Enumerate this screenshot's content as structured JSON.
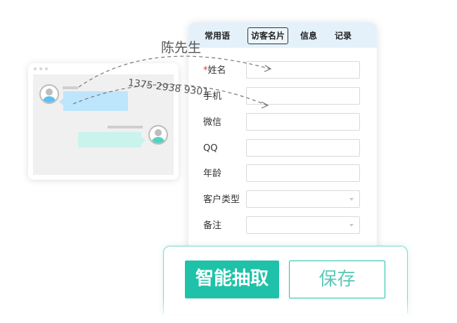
{
  "tabs": [
    "常用语",
    "访客名片",
    "信息",
    "记录"
  ],
  "active_tab": "访客名片",
  "fields": [
    {
      "label": "姓名",
      "required": true,
      "type": "text",
      "value": ""
    },
    {
      "label": "手机",
      "required": false,
      "type": "text",
      "value": ""
    },
    {
      "label": "微信",
      "required": false,
      "type": "text",
      "value": ""
    },
    {
      "label": "QQ",
      "required": false,
      "type": "text",
      "value": ""
    },
    {
      "label": "年龄",
      "required": false,
      "type": "text",
      "value": ""
    },
    {
      "label": "客户类型",
      "required": false,
      "type": "select",
      "value": ""
    },
    {
      "label": "备注",
      "required": false,
      "type": "select",
      "value": ""
    }
  ],
  "required_mark": "*",
  "annotations": {
    "name": "陈先生",
    "phone": "1375 2938 9301"
  },
  "actions": {
    "extract_label": "智能抽取",
    "save_label": "保存"
  },
  "colors": {
    "accent": "#1fc2a8",
    "tab_bar_bg": "#e4f1fb",
    "required": "#e03434",
    "left_bubble": "#bde5fb",
    "right_bubble": "#c9f3ec"
  }
}
